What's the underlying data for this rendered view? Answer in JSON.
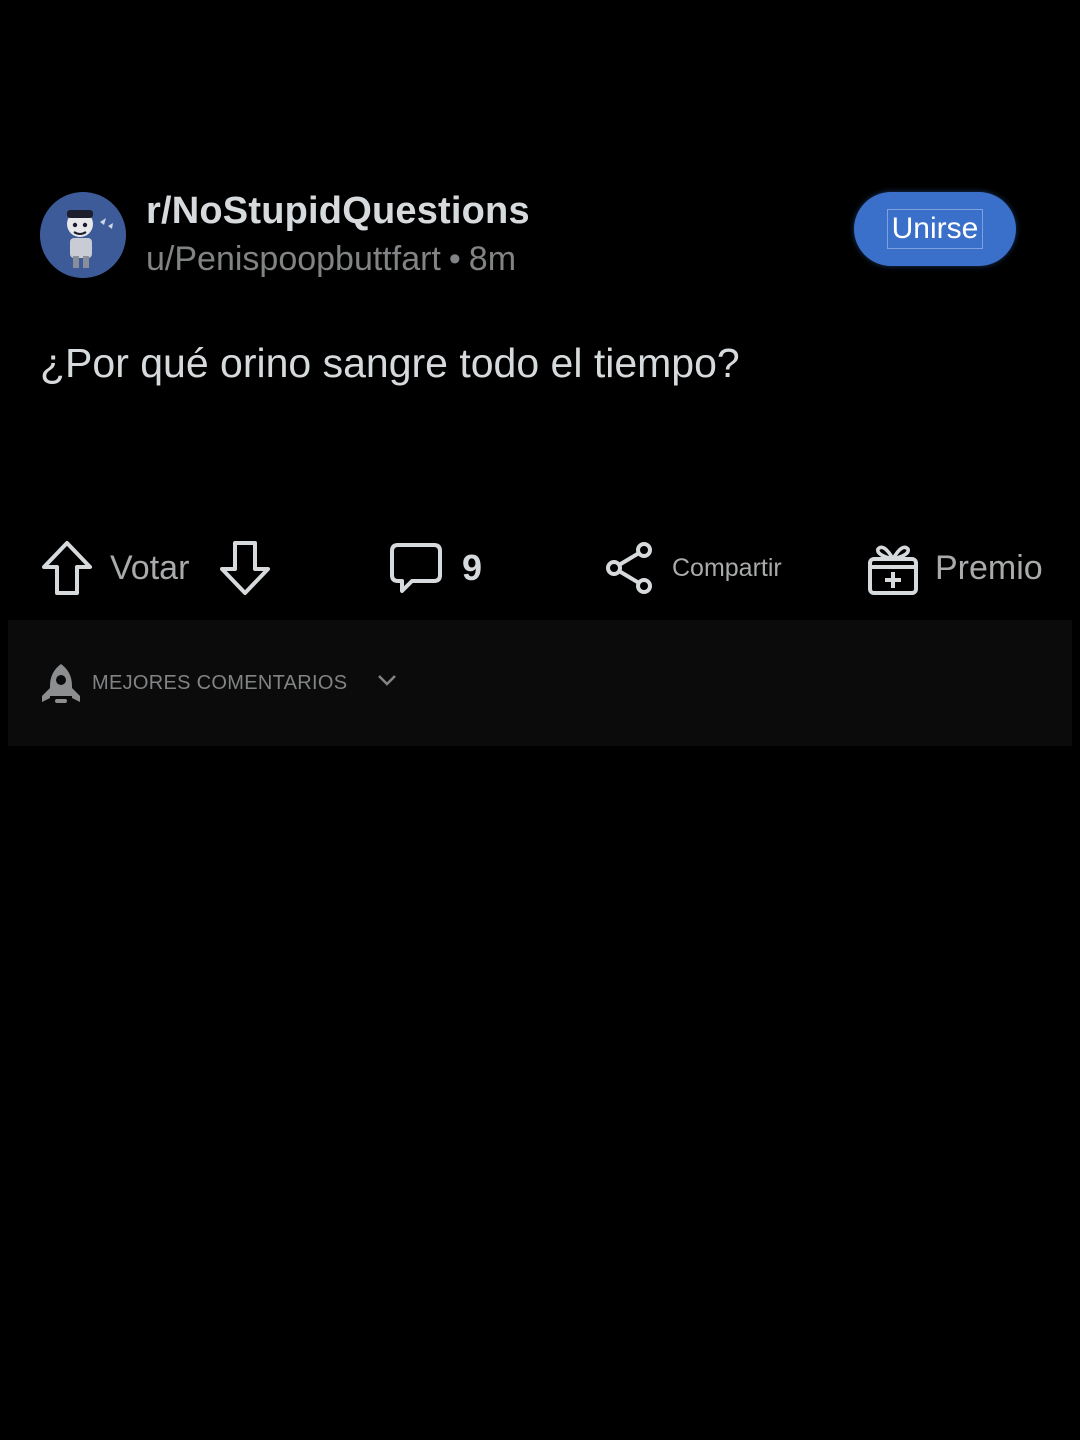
{
  "post": {
    "subreddit": "r/NoStupidQuestions",
    "author": "u/Penispoopbuttfart",
    "separator": "•",
    "age": "8m",
    "join_label": "Unirse",
    "title": "¿Por qué orino sangre todo el tiempo?"
  },
  "actions": {
    "vote_label": "Votar",
    "comment_count": "9",
    "share_label": "Compartir",
    "award_label": "Premio"
  },
  "sort": {
    "label": "MEJORES COMENTARIOS"
  },
  "colors": {
    "background": "#000000",
    "accent": "#3a70c9",
    "text": "#d7dadc",
    "muted": "#818384"
  },
  "icons": [
    "avatar",
    "upvote-arrow-icon",
    "downvote-arrow-icon",
    "comment-bubble-icon",
    "share-icon",
    "gift-icon",
    "rocket-icon",
    "chevron-down-icon"
  ]
}
